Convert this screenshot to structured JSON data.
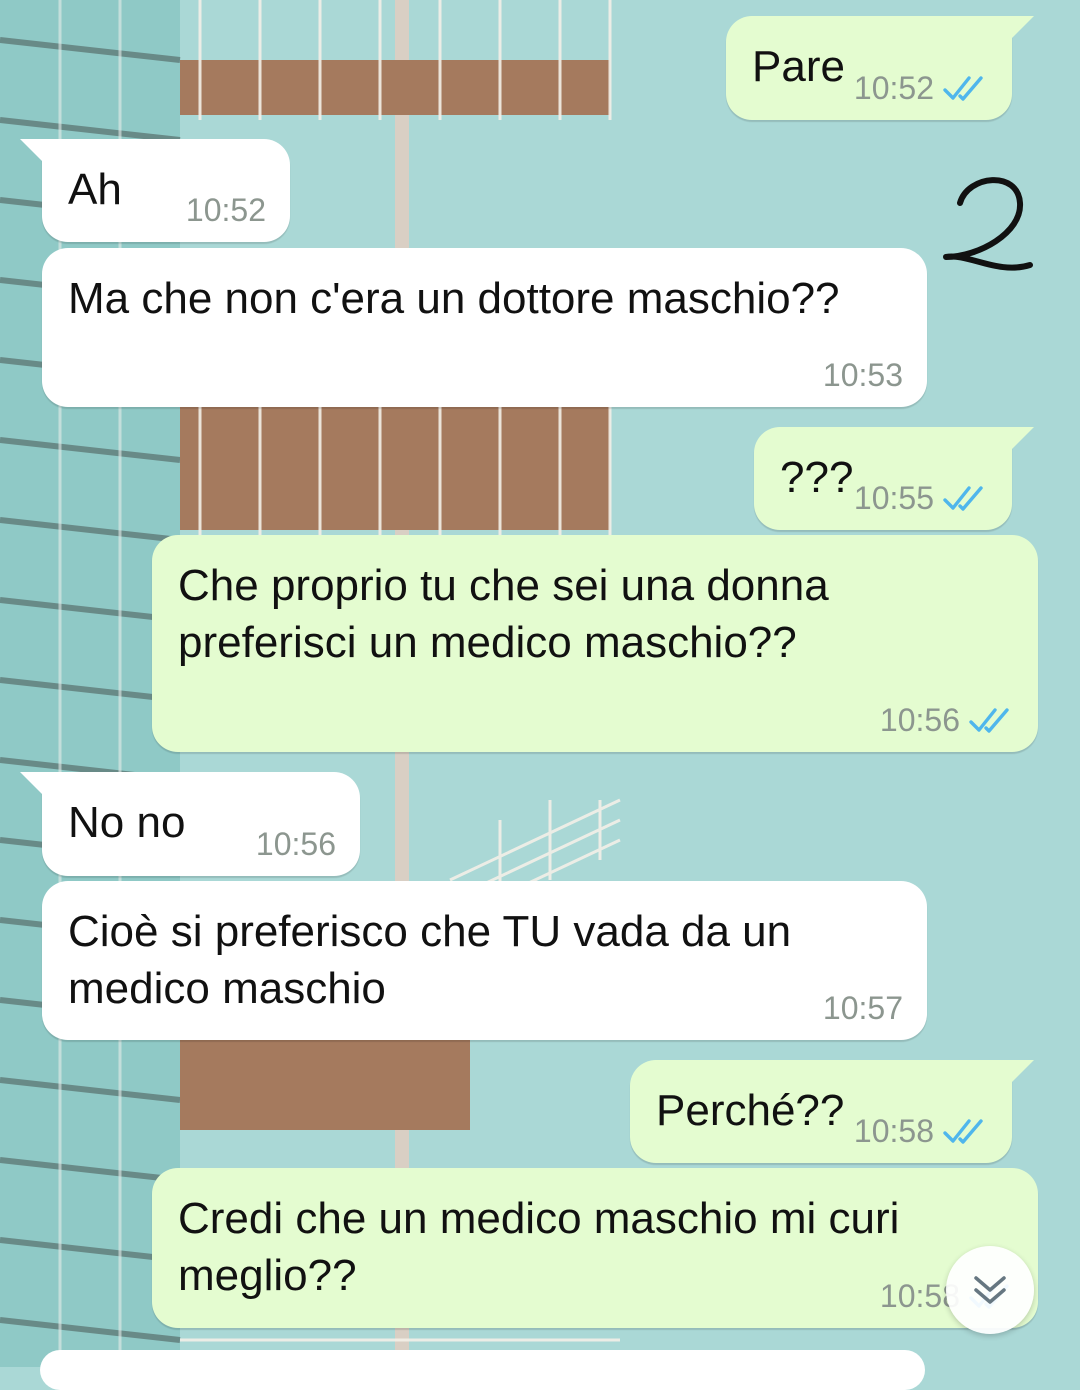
{
  "chat": {
    "messages": [
      {
        "direction": "out",
        "text": "Pare",
        "time": "10:52",
        "read": true
      },
      {
        "direction": "in",
        "text": "Ah",
        "time": "10:52"
      },
      {
        "direction": "in",
        "text": "Ma che non c'era un dottore maschio??",
        "time": "10:53"
      },
      {
        "direction": "out",
        "text": "???",
        "time": "10:55",
        "read": true
      },
      {
        "direction": "out",
        "text": "Che proprio tu che sei una donna\npreferisci un medico maschio??",
        "time": "10:56",
        "read": true
      },
      {
        "direction": "in",
        "text": "No no",
        "time": "10:56"
      },
      {
        "direction": "in",
        "text": "Cioè si preferisco che TU vada da un\nmedico maschio",
        "time": "10:57"
      },
      {
        "direction": "out",
        "text": "Perché??",
        "time": "10:58",
        "read": true
      },
      {
        "direction": "out",
        "text": "Credi che un medico maschio mi curi\nmeglio??",
        "time": "10:58",
        "read": true
      }
    ]
  },
  "annotation": {
    "text": "2"
  },
  "icons": {
    "read_receipt": "double-check-icon",
    "scroll_down": "chevron-down-icon"
  },
  "colors": {
    "incoming_bubble": "#ffffff",
    "outgoing_bubble": "#e4fcd0",
    "read_tick": "#4fb6ec",
    "timestamp": "#8c968f",
    "wallpaper_sky": "#aad8d6"
  }
}
